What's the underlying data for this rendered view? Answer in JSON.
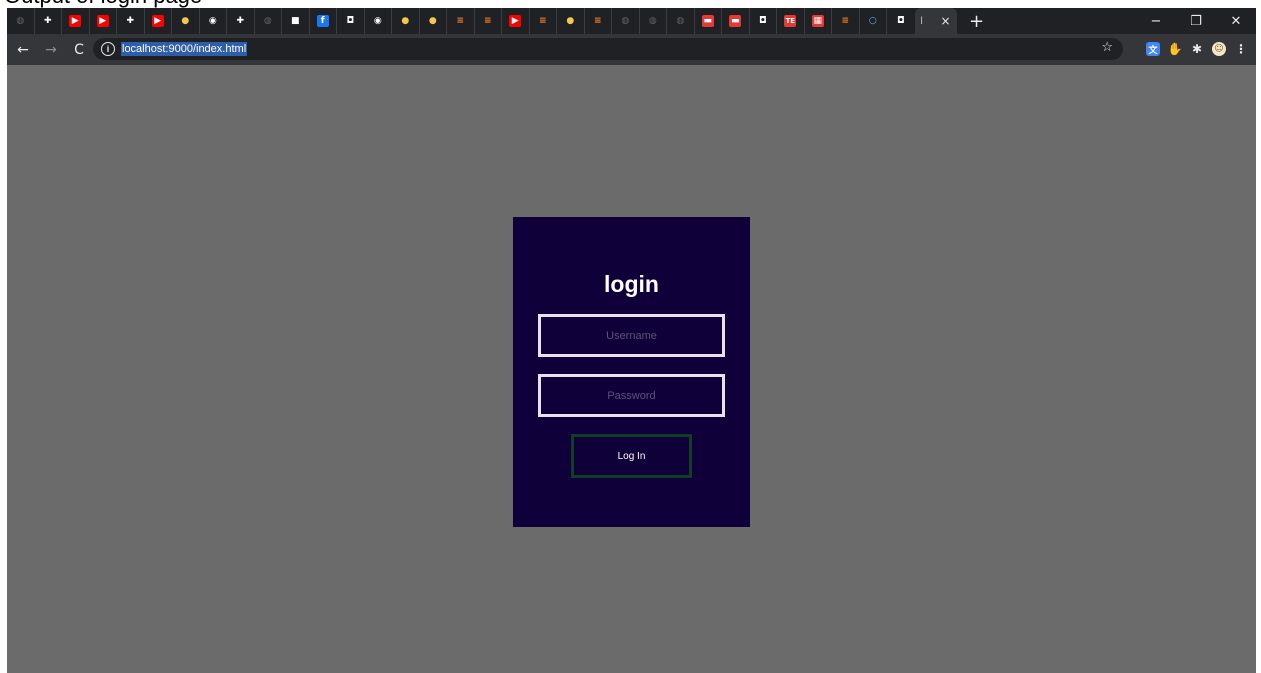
{
  "caption": "Output of login page",
  "browser": {
    "tabs": [
      {
        "icon": "globe-icon",
        "color": "#5f6368"
      },
      {
        "icon": "plus-badge-icon",
        "color": "#ffffff"
      },
      {
        "icon": "youtube-icon",
        "color": "#ff0000"
      },
      {
        "icon": "youtube-icon",
        "color": "#ff0000"
      },
      {
        "icon": "plus-badge-icon",
        "color": "#ffffff"
      },
      {
        "icon": "youtube-icon",
        "color": "#ff0000"
      },
      {
        "icon": "python-icon",
        "color": "#f2c94c"
      },
      {
        "icon": "github-icon",
        "color": "#ffffff"
      },
      {
        "icon": "plus-badge-icon",
        "color": "#ffffff"
      },
      {
        "icon": "globe-icon",
        "color": "#5f6368"
      },
      {
        "icon": "camera-icon",
        "color": "#ffffff"
      },
      {
        "icon": "facebook-icon",
        "color": "#1877f2"
      },
      {
        "icon": "bookmark-icon",
        "color": "#ffffff"
      },
      {
        "icon": "github-icon",
        "color": "#ffffff"
      },
      {
        "icon": "python-icon",
        "color": "#f2c94c"
      },
      {
        "icon": "python-icon",
        "color": "#f2c94c"
      },
      {
        "icon": "stackoverflow-icon",
        "color": "#f48024"
      },
      {
        "icon": "stackoverflow-icon",
        "color": "#f48024"
      },
      {
        "icon": "youtube-icon",
        "color": "#ff0000"
      },
      {
        "icon": "stackoverflow-icon",
        "color": "#f48024"
      },
      {
        "icon": "python-icon",
        "color": "#f2c94c"
      },
      {
        "icon": "stackoverflow-icon",
        "color": "#f48024"
      },
      {
        "icon": "globe-icon",
        "color": "#5f6368"
      },
      {
        "icon": "globe-icon",
        "color": "#5f6368"
      },
      {
        "icon": "globe-icon",
        "color": "#5f6368"
      },
      {
        "icon": "flag-icon",
        "color": "#e53935"
      },
      {
        "icon": "flag-icon",
        "color": "#e53935"
      },
      {
        "icon": "bookmark-icon",
        "color": "#ffffff"
      },
      {
        "icon": "te-icon",
        "color": "#e53935",
        "text": "TE"
      },
      {
        "icon": "grid-icon",
        "color": "#e53935"
      },
      {
        "icon": "stackoverflow-icon",
        "color": "#f48024"
      },
      {
        "icon": "search-icon",
        "color": "#4fc3f7"
      },
      {
        "icon": "bookmark-icon",
        "color": "#ffffff"
      }
    ],
    "active_tab": {
      "label": "l",
      "close": "×"
    },
    "new_tab": "+",
    "window_controls": {
      "minimize": "−",
      "restore": "❐",
      "close": "✕"
    },
    "nav": {
      "back": "←",
      "forward": "→",
      "reload": "C"
    },
    "address_bar": {
      "info": "i",
      "url": "localhost:9000/index.html",
      "star": "☆"
    },
    "extensions": [
      {
        "icon": "translate-icon",
        "color": "#4285f4"
      },
      {
        "icon": "adblock-icon",
        "color": "#e53935"
      },
      {
        "icon": "puzzle-icon",
        "color": "#e8eaed"
      },
      {
        "icon": "profile-avatar-icon",
        "color": "#f5e6c8"
      },
      {
        "icon": "menu-kebab-icon",
        "color": "#e8eaed"
      }
    ]
  },
  "login": {
    "title": "login",
    "username_placeholder": "Username",
    "password_placeholder": "Password",
    "button_label": "Log In"
  },
  "colors": {
    "page_bg": "#6b6b6b",
    "card_bg": "#10003a",
    "field_border": "#e8e2ee",
    "button_border": "#123d22"
  }
}
